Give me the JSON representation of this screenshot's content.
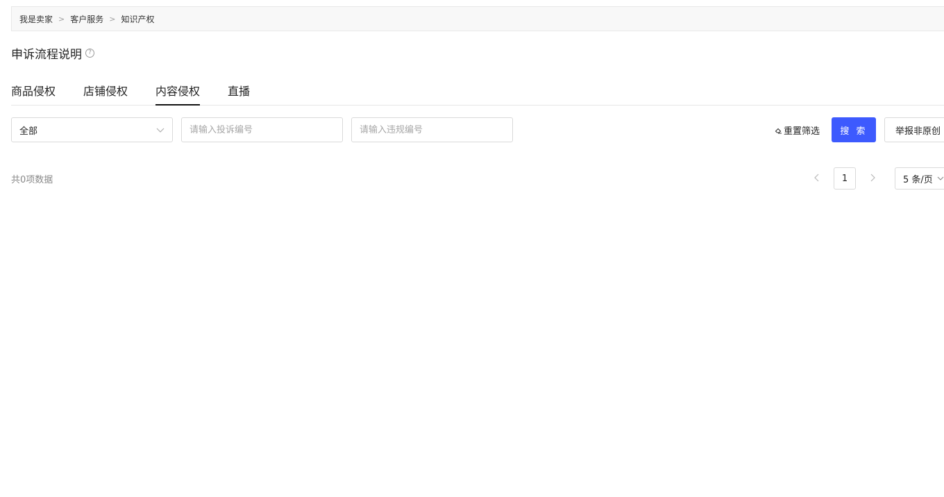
{
  "breadcrumb": {
    "items": [
      "我是卖家",
      "客户服务",
      "知识产权"
    ],
    "separator": ">"
  },
  "page_title": {
    "text": "申诉流程说明",
    "help_icon": "question-circle-icon",
    "help_glyph": "?"
  },
  "tabs": [
    {
      "label": "商品侵权",
      "active": false
    },
    {
      "label": "店铺侵权",
      "active": false
    },
    {
      "label": "内容侵权",
      "active": true
    },
    {
      "label": "直播",
      "active": false
    }
  ],
  "filters": {
    "status_select": {
      "value": "全部",
      "icon": "chevron-down-icon"
    },
    "complaint_input": {
      "value": "",
      "placeholder": "请输入投诉编号"
    },
    "violation_input": {
      "value": "",
      "placeholder": "请输入违规编号"
    }
  },
  "actions": {
    "reset_label": "重置筛选",
    "reset_icon": "eraser-icon",
    "search_label": "搜 索",
    "report_label": "举报非原创"
  },
  "results": {
    "total_text": "共0项数据"
  },
  "pagination": {
    "current_page": "1",
    "page_size": "5 条/页",
    "prev_icon": "chevron-left-icon",
    "next_icon": "chevron-right-icon"
  },
  "colors": {
    "primary": "#3d5afe",
    "border": "#d9d9d9",
    "breadcrumb_bg": "#f8f8f8",
    "muted_text": "#888888"
  }
}
